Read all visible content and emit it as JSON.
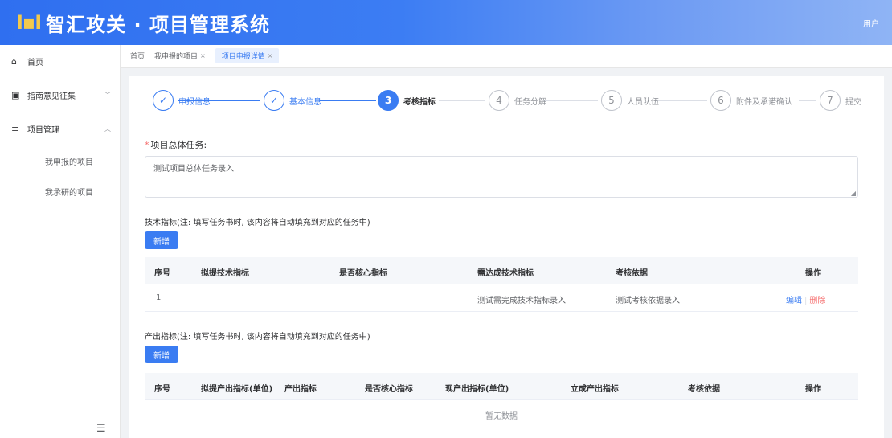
{
  "header": {
    "logo_mark": "I▪I",
    "title": "智汇攻关 · 项目管理系统",
    "user": "用户"
  },
  "sidebar": {
    "items": [
      {
        "icon": "home-icon",
        "glyph": "⌂",
        "label": "首页"
      },
      {
        "icon": "document-icon",
        "glyph": "▣",
        "label": "指南意见征集"
      },
      {
        "icon": "menu-icon",
        "glyph": "≡",
        "label": "项目管理"
      }
    ],
    "sub_items": [
      "我申报的项目",
      "我承研的项目"
    ],
    "collapse_glyph": "☰"
  },
  "tabs": [
    {
      "label": "首页"
    },
    {
      "label": "我申报的项目"
    },
    {
      "label": "项目申报详情"
    }
  ],
  "steps": [
    {
      "num": "1",
      "glyph": "✓",
      "title": "申报信息",
      "status": "done"
    },
    {
      "num": "2",
      "glyph": "✓",
      "title": "基本信息",
      "status": "done"
    },
    {
      "num": "3",
      "glyph": "3",
      "title": "考核指标",
      "status": "active"
    },
    {
      "num": "4",
      "glyph": "4",
      "title": "任务分解",
      "status": "todo"
    },
    {
      "num": "5",
      "glyph": "5",
      "title": "人员队伍",
      "status": "todo"
    },
    {
      "num": "6",
      "glyph": "6",
      "title": "附件及承诺确认",
      "status": "todo"
    },
    {
      "num": "7",
      "glyph": "7",
      "title": "提交",
      "status": "todo"
    }
  ],
  "form": {
    "required_mark": "*",
    "total_task_label": "项目总体任务:",
    "total_task_value": "测试项目总体任务录入"
  },
  "tech_section": {
    "hint": "技术指标(注: 填写任务书时, 该内容将自动填充到对应的任务中)",
    "add_label": "新增",
    "columns": [
      "序号",
      "拟提技术指标",
      "是否核心指标",
      "需达成技术指标",
      "考核依据",
      "操作"
    ],
    "rows": [
      {
        "index": "1",
        "proposed": "",
        "core": "",
        "target": "测试需完成技术指标录入",
        "basis": "测试考核依据录入",
        "edit": "编辑",
        "delete": "删除"
      }
    ]
  },
  "output_section": {
    "hint": "产出指标(注: 填写任务书时, 该内容将自动填充到对应的任务中)",
    "add_label": "新增",
    "columns": [
      "序号",
      "拟提产出指标(单位)",
      "产出指标",
      "是否核心指标",
      "现产出指标(单位)",
      "立成产出指标",
      "考核依据",
      "操作"
    ],
    "empty_text": "暂无数据"
  }
}
